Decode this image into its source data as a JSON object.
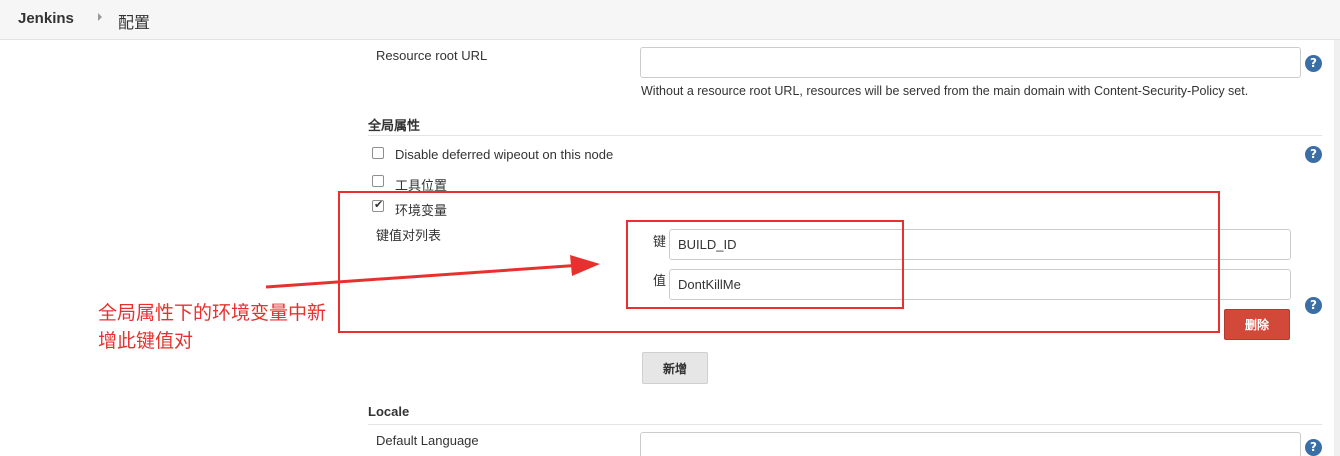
{
  "breadcrumb": {
    "home": "Jenkins",
    "current": "配置"
  },
  "resource_root": {
    "label": "Resource root URL",
    "value": "",
    "description": "Without a resource root URL, resources will be served from the main domain with Content-Security-Policy set."
  },
  "global_properties": {
    "title": "全局属性",
    "disable_deferred_wipeout": {
      "label": "Disable deferred wipeout on this node",
      "checked": false
    },
    "tool_locations": {
      "label": "工具位置",
      "checked": false
    },
    "env_vars": {
      "label": "环境变量",
      "checked": true
    },
    "kv_list_label": "键值对列表",
    "key_label": "键",
    "key_value": "BUILD_ID",
    "value_label": "值",
    "value_value": "DontKillMe",
    "delete_label": "删除",
    "add_label": "新增"
  },
  "locale": {
    "title": "Locale",
    "default_language_label": "Default Language",
    "default_language_value": ""
  },
  "annotation": {
    "text": "全局属性下的环境变量中新增此键值对",
    "color": "#e8312f"
  },
  "icons": {
    "help": "?",
    "help_color": "#3b6ea5"
  }
}
